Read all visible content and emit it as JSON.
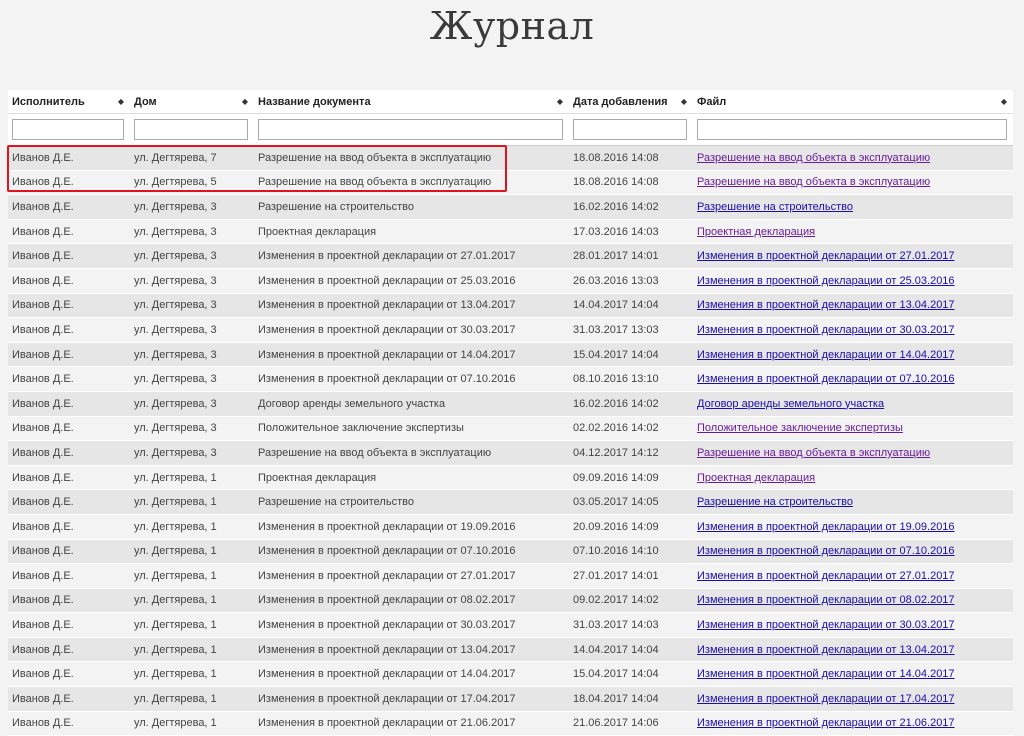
{
  "page": {
    "title": "Журнал"
  },
  "columns": [
    {
      "label": "Исполнитель"
    },
    {
      "label": "Дом"
    },
    {
      "label": "Название документа"
    },
    {
      "label": "Дата добавления"
    },
    {
      "label": "Файл"
    }
  ],
  "filters": [
    "",
    "",
    "",
    "",
    ""
  ],
  "colors": {
    "highlight": "#e0141e",
    "link": "#1a0dab",
    "visited_link": "#6a1b9a"
  },
  "rows": [
    {
      "executor": "Иванов Д.Е.",
      "house": "ул. Дегтярева, 7",
      "name": "Разрешение на ввод объекта в эксплуатацию",
      "date": "18.08.2016 14:08",
      "file": "Разрешение на ввод объекта в эксплуатацию",
      "visited": true
    },
    {
      "executor": "Иванов Д.Е.",
      "house": "ул. Дегтярева, 5",
      "name": "Разрешение на ввод объекта в эксплуатацию",
      "date": "18.08.2016 14:08",
      "file": "Разрешение на ввод объекта в эксплуатацию",
      "visited": true
    },
    {
      "executor": "Иванов Д.Е.",
      "house": "ул. Дегтярева, 3",
      "name": "Разрешение на строительство",
      "date": "16.02.2016 14:02",
      "file": "Разрешение на строительство",
      "visited": false
    },
    {
      "executor": "Иванов Д.Е.",
      "house": "ул. Дегтярева, 3",
      "name": "Проектная декларация",
      "date": "17.03.2016 14:03",
      "file": "Проектная декларация",
      "visited": true
    },
    {
      "executor": "Иванов Д.Е.",
      "house": "ул. Дегтярева, 3",
      "name": "Изменения в проектной декларации от 27.01.2017",
      "date": "28.01.2017 14:01",
      "file": "Изменения в проектной декларации от 27.01.2017",
      "visited": false
    },
    {
      "executor": "Иванов Д.Е.",
      "house": "ул. Дегтярева, 3",
      "name": "Изменения в проектной декларации от 25.03.2016",
      "date": "26.03.2016 13:03",
      "file": "Изменения в проектной декларации от 25.03.2016",
      "visited": false
    },
    {
      "executor": "Иванов Д.Е.",
      "house": "ул. Дегтярева, 3",
      "name": "Изменения в проектной декларации от 13.04.2017",
      "date": "14.04.2017 14:04",
      "file": "Изменения в проектной декларации от 13.04.2017",
      "visited": false
    },
    {
      "executor": "Иванов Д.Е.",
      "house": "ул. Дегтярева, 3",
      "name": "Изменения в проектной декларации от 30.03.2017",
      "date": "31.03.2017 13:03",
      "file": "Изменения в проектной декларации от 30.03.2017",
      "visited": false
    },
    {
      "executor": "Иванов Д.Е.",
      "house": "ул. Дегтярева, 3",
      "name": "Изменения в проектной декларации от 14.04.2017",
      "date": "15.04.2017 14:04",
      "file": "Изменения в проектной декларации от 14.04.2017",
      "visited": false
    },
    {
      "executor": "Иванов Д.Е.",
      "house": "ул. Дегтярева, 3",
      "name": "Изменения в проектной декларации от 07.10.2016",
      "date": "08.10.2016 13:10",
      "file": "Изменения в проектной декларации от 07.10.2016",
      "visited": false
    },
    {
      "executor": "Иванов Д.Е.",
      "house": "ул. Дегтярева, 3",
      "name": "Договор аренды земельного участка",
      "date": "16.02.2016 14:02",
      "file": "Договор аренды земельного участка",
      "visited": false
    },
    {
      "executor": "Иванов Д.Е.",
      "house": "ул. Дегтярева, 3",
      "name": "Положительное заключение экспертизы",
      "date": "02.02.2016 14:02",
      "file": "Положительное заключение экспертизы",
      "visited": true
    },
    {
      "executor": "Иванов Д.Е.",
      "house": "ул. Дегтярева, 3",
      "name": "Разрешение на ввод объекта в эксплуатацию",
      "date": "04.12.2017 14:12",
      "file": "Разрешение на ввод объекта в эксплуатацию",
      "visited": true
    },
    {
      "executor": "Иванов Д.Е.",
      "house": "ул. Дегтярева, 1",
      "name": "Проектная декларация",
      "date": "09.09.2016 14:09",
      "file": "Проектная декларация",
      "visited": true
    },
    {
      "executor": "Иванов Д.Е.",
      "house": "ул. Дегтярева, 1",
      "name": "Разрешение на строительство",
      "date": "03.05.2017 14:05",
      "file": "Разрешение на строительство",
      "visited": false
    },
    {
      "executor": "Иванов Д.Е.",
      "house": "ул. Дегтярева, 1",
      "name": "Изменения в проектной декларации от 19.09.2016",
      "date": "20.09.2016 14:09",
      "file": "Изменения в проектной декларации от 19.09.2016",
      "visited": false
    },
    {
      "executor": "Иванов Д.Е.",
      "house": "ул. Дегтярева, 1",
      "name": "Изменения в проектной декларации от 07.10.2016",
      "date": "07.10.2016 14:10",
      "file": "Изменения в проектной декларации от 07.10.2016",
      "visited": false
    },
    {
      "executor": "Иванов Д.Е.",
      "house": "ул. Дегтярева, 1",
      "name": "Изменения в проектной декларации от 27.01.2017",
      "date": "27.01.2017 14:01",
      "file": "Изменения в проектной декларации от 27.01.2017",
      "visited": false
    },
    {
      "executor": "Иванов Д.Е.",
      "house": "ул. Дегтярева, 1",
      "name": "Изменения в проектной декларации от 08.02.2017",
      "date": "09.02.2017 14:02",
      "file": "Изменения в проектной декларации от 08.02.2017",
      "visited": false
    },
    {
      "executor": "Иванов Д.Е.",
      "house": "ул. Дегтярева, 1",
      "name": "Изменения в проектной декларации от 30.03.2017",
      "date": "31.03.2017 14:03",
      "file": "Изменения в проектной декларации от 30.03.2017",
      "visited": false
    },
    {
      "executor": "Иванов Д.Е.",
      "house": "ул. Дегтярева, 1",
      "name": "Изменения в проектной декларации от 13.04.2017",
      "date": "14.04.2017 14:04",
      "file": "Изменения в проектной декларации от 13.04.2017",
      "visited": false
    },
    {
      "executor": "Иванов Д.Е.",
      "house": "ул. Дегтярева, 1",
      "name": "Изменения в проектной декларации от 14.04.2017",
      "date": "15.04.2017 14:04",
      "file": "Изменения в проектной декларации от 14.04.2017",
      "visited": false
    },
    {
      "executor": "Иванов Д.Е.",
      "house": "ул. Дегтярева, 1",
      "name": "Изменения в проектной декларации от 17.04.2017",
      "date": "18.04.2017 14:04",
      "file": "Изменения в проектной декларации от 17.04.2017",
      "visited": false
    },
    {
      "executor": "Иванов Д.Е.",
      "house": "ул. Дегтярева, 1",
      "name": "Изменения в проектной декларации от 21.06.2017",
      "date": "21.06.2017 14:06",
      "file": "Изменения в проектной декларации от 21.06.2017",
      "visited": false
    }
  ]
}
